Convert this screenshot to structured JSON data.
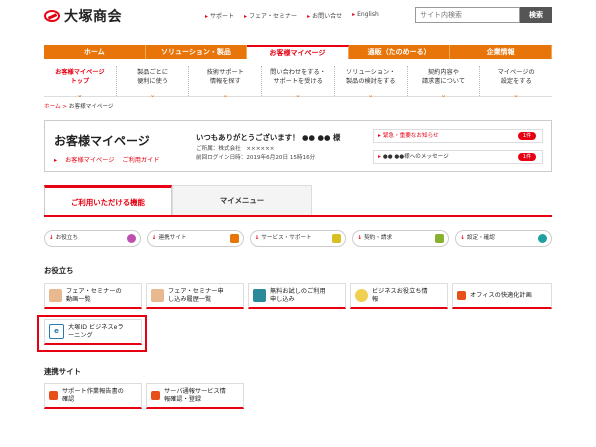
{
  "header": {
    "logo_text": "大塚商会",
    "top_links": [
      "サポート",
      "フェア・セミナー",
      "お問い合せ",
      "English"
    ],
    "search_placeholder": "サイト内検索",
    "search_button": "検索"
  },
  "nav": {
    "items": [
      {
        "label": "ホーム",
        "active": false
      },
      {
        "label": "ソリューション・製品",
        "active": false
      },
      {
        "label": "お客様マイページ",
        "active": true
      },
      {
        "label": "通販（たのめーる）",
        "active": false
      },
      {
        "label": "企業情報",
        "active": false
      }
    ]
  },
  "subnav": {
    "items": [
      {
        "label": "お客様マイページ\nトップ",
        "active": true
      },
      {
        "label": "製品ごとに\n便利に使う",
        "active": false
      },
      {
        "label": "技術サポート\n情報を探す",
        "active": false
      },
      {
        "label": "問い合わせをする・\nサポートを受ける",
        "active": false
      },
      {
        "label": "ソリューション・\n製品の検討をする",
        "active": false
      },
      {
        "label": "契約内容や\n請求書について",
        "active": false
      },
      {
        "label": "マイページの\n設定をする",
        "active": false
      }
    ]
  },
  "breadcrumb": {
    "home": "ホーム",
    "sep": " > ",
    "current": "お客様マイページ"
  },
  "mypage": {
    "title": "お客様マイページ",
    "link_top": "お客様マイページ",
    "link_guide": "ご利用ガイド",
    "greeting": "いつもありがとうございます！ ●● ●● 様",
    "company": "ご所属：株式会社　××××××",
    "last_login": "前回ログイン日時：2019年6月20日 15時16分",
    "notices": [
      {
        "label": "緊急・重要なお知らせ",
        "count": "1件"
      },
      {
        "label": "●● ●●様へのメッセージ",
        "count": "1件"
      }
    ]
  },
  "tabs": {
    "active": "ご利用いただける機能",
    "other": "マイメニュー"
  },
  "categories": [
    {
      "label": "お役立ち",
      "color": "#c050b0"
    },
    {
      "label": "連携サイト",
      "color": "#e8750a"
    },
    {
      "label": "サービス・サポート",
      "color": "#d8c020"
    },
    {
      "label": "契約・請求",
      "color": "#8ab030"
    },
    {
      "label": "設定・確認",
      "color": "#20a0a0"
    }
  ],
  "sections": {
    "useful": {
      "title": "お役立ち",
      "items": [
        {
          "label": "フェア・セミナーの\n動画一覧",
          "icon": "seminar-video-icon",
          "color": "#c07a40"
        },
        {
          "label": "フェア・セミナー申\nし込み履歴一覧",
          "icon": "seminar-history-icon",
          "color": "#c07a40"
        },
        {
          "label": "無料お試しのご利用\n申し込み",
          "icon": "trial-icon",
          "color": "#2a8a9a"
        },
        {
          "label": "ビジネスお役立ち情\n報",
          "icon": "lightbulb-icon",
          "color": "#e8c030"
        },
        {
          "label": "オフィスの快適化計画",
          "icon": "play-icon",
          "color": "#e8501a"
        },
        {
          "label": "大塚ID ビジネスeラ\nーニング",
          "icon": "elearning-icon",
          "color": "#2a7ab0"
        }
      ]
    },
    "linked": {
      "title": "連携サイト",
      "items": [
        {
          "label": "サポート作業報告書の\n確認",
          "icon": "report-icon",
          "color": "#e8501a"
        },
        {
          "label": "サーバ通報サービス情\n報確認・登録",
          "icon": "server-icon",
          "color": "#e8501a"
        }
      ]
    }
  }
}
